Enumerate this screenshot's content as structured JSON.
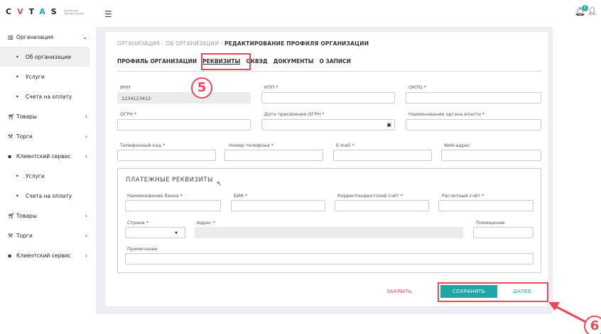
{
  "logo": {
    "letters": [
      "C",
      "V",
      "T",
      "A",
      "S"
    ],
    "subtitle": "центральная торговая система"
  },
  "sidebar": {
    "items": [
      {
        "label": "Организация",
        "icon": "building-icon",
        "expanded": true
      },
      {
        "label": "Об организации",
        "sub": true,
        "active": true
      },
      {
        "label": "Услуги",
        "sub": true
      },
      {
        "label": "Счета на оплату",
        "sub": true
      },
      {
        "label": "Товары",
        "icon": "cart-icon"
      },
      {
        "label": "Торги",
        "icon": "gavel-icon"
      },
      {
        "label": "Клиентский сервис",
        "icon": "chat-icon"
      },
      {
        "label": "Услуги",
        "sub": true
      },
      {
        "label": "Счета на оплату",
        "sub": true
      },
      {
        "label": "Товары",
        "icon": "cart-icon"
      },
      {
        "label": "Торги",
        "icon": "gavel-icon"
      },
      {
        "label": "Клиентский сервис",
        "icon": "chat-icon"
      }
    ]
  },
  "header": {
    "notification_count": "1"
  },
  "breadcrumb": {
    "part1": "ОРГАНИЗАЦИЯ",
    "sep": " - ",
    "part2": "ОБ ОРГАНИЗАЦИИ",
    "current": "РЕДАКТИРОВАНИЕ ПРОФИЛЯ ОРГАНИЗАЦИИ"
  },
  "tabs": [
    "ПРОФИЛЬ ОРГАНИЗАЦИИ",
    "РЕКВИЗИТЫ",
    "ОКВЭД",
    "ДОКУМЕНТЫ",
    "О ЗАПИСИ"
  ],
  "active_tab": "РЕКВИЗИТЫ",
  "form": {
    "inn_label": "ИНН",
    "inn_value": "1234123412",
    "kpp_label": "КПП *",
    "okpo_label": "ОКПО *",
    "ogrn_label": "ОГРН *",
    "ogrn_date_label": "Дата присвоения ОГРН *",
    "authority_label": "Наименование органа власти *",
    "phone_code_label": "Телефонный код *",
    "phone_label": "Номер телефона *",
    "email_label": "E-mail *",
    "web_label": "Web-адрес"
  },
  "payment": {
    "title": "ПЛАТЕЖНЫЕ РЕКВИЗИТЫ",
    "bank_label": "Наименование банка *",
    "bik_label": "БИК *",
    "corr_label": "Корреспондентский счёт *",
    "account_label": "Расчетный счёт *",
    "country_label": "Страна *",
    "address_label": "Адрес *",
    "room_label": "Помещение",
    "note_label": "Примечание"
  },
  "actions": {
    "close": "ЗАКРЫТЬ",
    "save": "СОХРАНИТЬ",
    "next": "ДАЛЕЕ"
  },
  "annotations": {
    "step5": "5",
    "step6": "6"
  },
  "colors": {
    "accent": "#1fa6a6",
    "highlight": "#e8485a",
    "workspace": "#eceef1"
  }
}
